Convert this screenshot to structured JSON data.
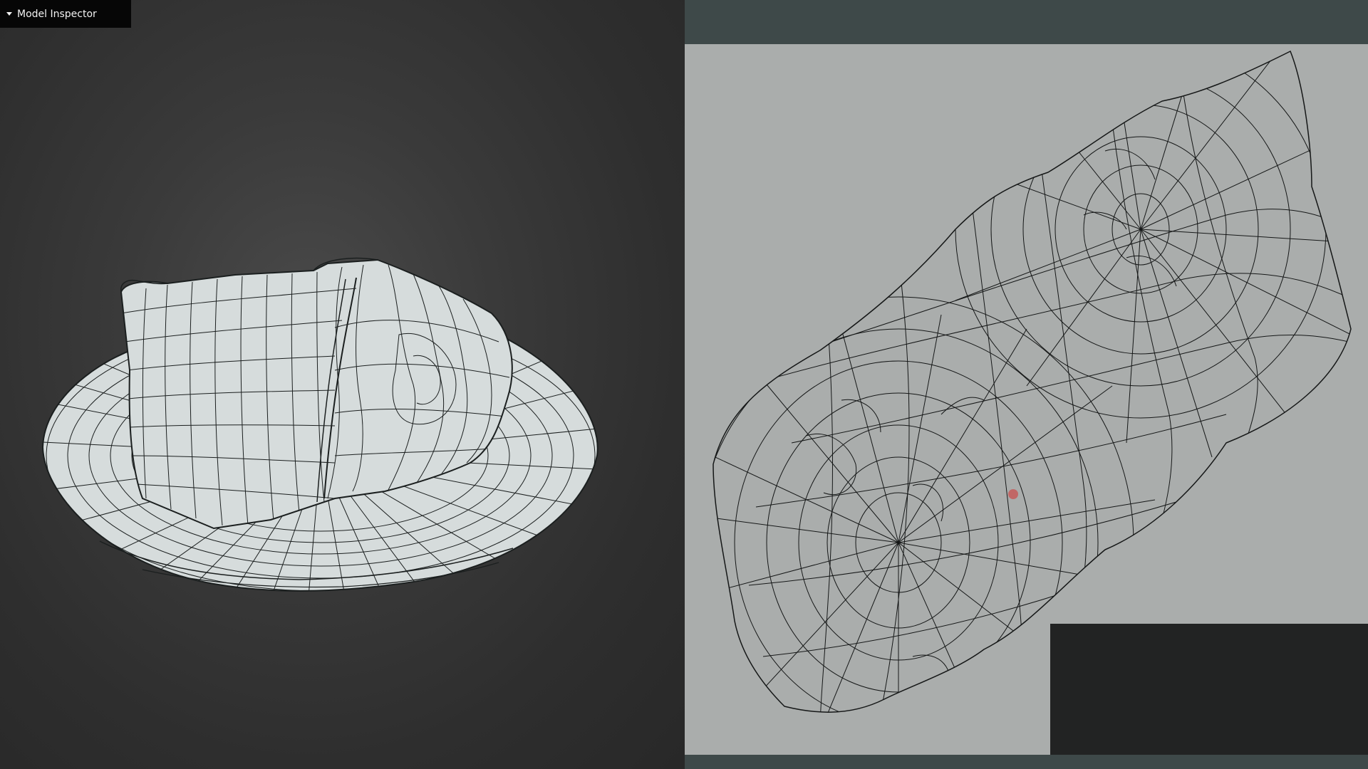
{
  "inspector": {
    "label": "Model Inspector",
    "caret_icon": "caret-down-icon"
  },
  "viewport": {
    "background_color": "#333333",
    "model_fill": "#d6dcdc",
    "wire_color": "#1b1f1f"
  },
  "uv_editor": {
    "bar_color": "#3e4949",
    "canvas_color": "#aaadac",
    "cursor_color": "#c8504f"
  }
}
